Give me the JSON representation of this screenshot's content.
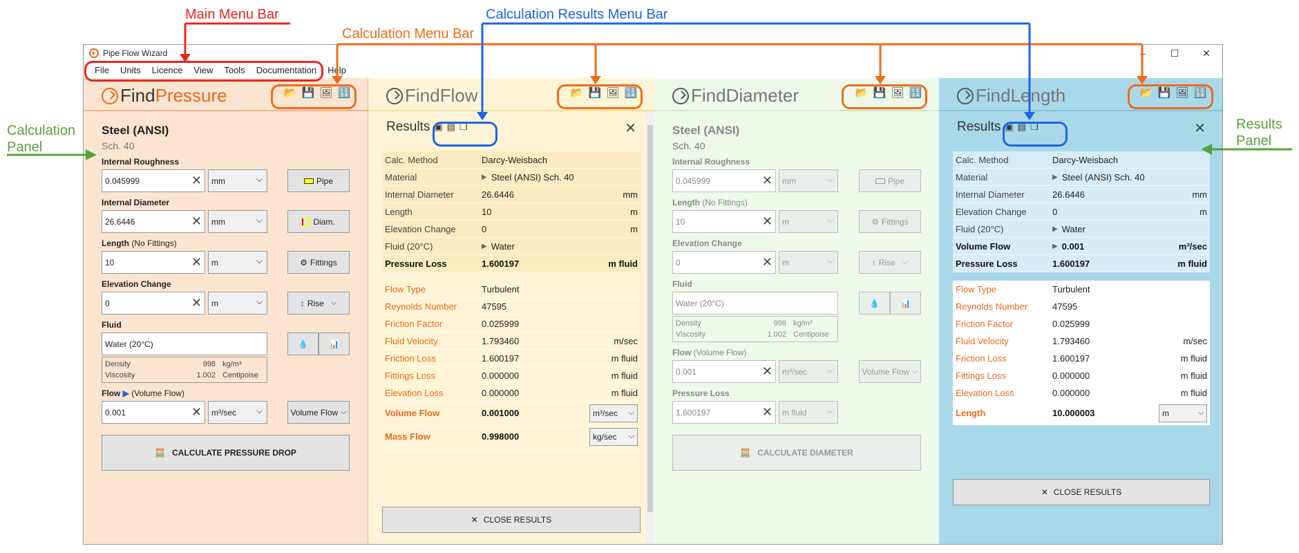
{
  "annotations": {
    "main_menu_bar": "Main Menu Bar",
    "calculation_menu_bar": "Calculation Menu Bar",
    "calculation_results_menu_bar": "Calculation Results Menu Bar",
    "calculation_panel": "Calculation\nPanel",
    "results_panel": "Results\nPanel"
  },
  "window": {
    "title": "Pipe Flow Wizard"
  },
  "menu": [
    "File",
    "Units",
    "Licence",
    "View",
    "Tools",
    "Documentation",
    "Help"
  ],
  "pressure": {
    "title_a": "Find",
    "title_b": "Pressure",
    "material": "Steel (ANSI)",
    "schedule": "Sch. 40",
    "rough_label": "Internal Roughness",
    "rough_value": "0.045999",
    "rough_unit": "mm",
    "pipe_btn": "Pipe",
    "diam_label": "Internal Diameter",
    "diam_value": "26.6446",
    "diam_unit": "mm",
    "diam_btn": "Diam.",
    "len_label": "Length",
    "len_sub": "(No Fittings)",
    "len_value": "10",
    "len_unit": "m",
    "fit_btn": "Fittings",
    "elev_label": "Elevation Change",
    "elev_value": "0",
    "elev_unit": "m",
    "rise_btn": "Rise",
    "fluid_label": "Fluid",
    "fluid_value": "Water (20°C)",
    "density_label": "Density",
    "density_value": "998",
    "density_unit": "kg/m³",
    "visc_label": "Viscosity",
    "visc_value": "1.002",
    "visc_unit": "Centipoise",
    "flow_label": "Flow",
    "flow_sub": "(Volume Flow)",
    "flow_value": "0.001",
    "flow_unit": "m³/sec",
    "flow_btn": "Volume Flow",
    "calc_btn": "CALCULATE PRESSURE DROP"
  },
  "flow": {
    "title_a": "Find",
    "title_b": "Flow",
    "results_title": "Results",
    "rows1": [
      [
        "Calc. Method",
        "Darcy-Weisbach",
        ""
      ],
      [
        "Material",
        "Steel (ANSI) Sch. 40",
        ""
      ],
      [
        "Internal Diameter",
        "26.6446",
        "mm"
      ],
      [
        "Length",
        "10",
        "m"
      ],
      [
        "Elevation Change",
        "0",
        "m"
      ],
      [
        "Fluid (20°C)",
        "Water",
        ""
      ],
      [
        "Pressure Loss",
        "1.600197",
        "m fluid"
      ]
    ],
    "rows2": [
      [
        "Flow Type",
        "Turbulent",
        ""
      ],
      [
        "Reynolds Number",
        "47595",
        ""
      ],
      [
        "Friction Factor",
        "0.025999",
        ""
      ],
      [
        "Fluid Velocity",
        "1.793460",
        "m/sec"
      ],
      [
        "Friction Loss",
        "1.600197",
        "m fluid"
      ],
      [
        "Fittings Loss",
        "0.000000",
        "m fluid"
      ],
      [
        "Elevation Loss",
        "0.000000",
        "m fluid"
      ]
    ],
    "vol_label": "Volume Flow",
    "vol_value": "0.001000",
    "vol_unit": "m³/sec",
    "mass_label": "Mass Flow",
    "mass_value": "0.998000",
    "mass_unit": "kg/sec",
    "close_btn": "CLOSE RESULTS"
  },
  "diam": {
    "title_a": "Find",
    "title_b": "Diameter",
    "material": "Steel (ANSI)",
    "schedule": "Sch. 40",
    "rough_label": "Internal Roughness",
    "rough_value": "0.045999",
    "rough_unit": "mm",
    "pipe_btn": "Pipe",
    "len_label": "Length",
    "len_sub": "(No Fittings)",
    "len_value": "10",
    "len_unit": "m",
    "fit_btn": "Fittings",
    "elev_label": "Elevation Change",
    "elev_value": "0",
    "elev_unit": "m",
    "rise_btn": "Rise",
    "fluid_label": "Fluid",
    "fluid_value": "Water (20°C)",
    "density_label": "Density",
    "density_value": "998",
    "density_unit": "kg/m³",
    "visc_label": "Viscosity",
    "visc_value": "1.002",
    "visc_unit": "Centipoise",
    "flow_label": "Flow",
    "flow_sub": "(Volume Flow)",
    "flow_value": "0.001",
    "flow_unit": "m³/sec",
    "flow_btn": "Volume Flow",
    "ploss_label": "Pressure Loss",
    "ploss_value": "1.600197",
    "ploss_unit": "m fluid",
    "calc_btn": "CALCULATE DIAMETER"
  },
  "length": {
    "title_a": "Find",
    "title_b": "Length",
    "results_title": "Results",
    "rows1": [
      [
        "Calc. Method",
        "Darcy-Weisbach",
        ""
      ],
      [
        "Material",
        "Steel (ANSI) Sch. 40",
        ""
      ],
      [
        "Internal Diameter",
        "26.6446",
        "mm"
      ],
      [
        "Elevation Change",
        "0",
        "m"
      ],
      [
        "Fluid (20°C)",
        "Water",
        ""
      ],
      [
        "Volume Flow",
        "0.001",
        "m³/sec"
      ],
      [
        "Pressure Loss",
        "1.600197",
        "m fluid"
      ]
    ],
    "rows2": [
      [
        "Flow Type",
        "Turbulent",
        ""
      ],
      [
        "Reynolds Number",
        "47595",
        ""
      ],
      [
        "Friction Factor",
        "0.025999",
        ""
      ],
      [
        "Fluid Velocity",
        "1.793460",
        "m/sec"
      ],
      [
        "Friction Loss",
        "1.600197",
        "m fluid"
      ],
      [
        "Fittings Loss",
        "0.000000",
        "m fluid"
      ],
      [
        "Elevation Loss",
        "0.000000",
        "m fluid"
      ]
    ],
    "len_label": "Length",
    "len_value": "10.000003",
    "len_unit": "m",
    "close_btn": "CLOSE RESULTS"
  },
  "colors": {
    "accent": "#e86a1e",
    "annotation_red": "#e8281e",
    "annotation_orange": "#ef6c1a",
    "annotation_blue": "#1e64e6",
    "annotation_green": "#5aa03c"
  }
}
